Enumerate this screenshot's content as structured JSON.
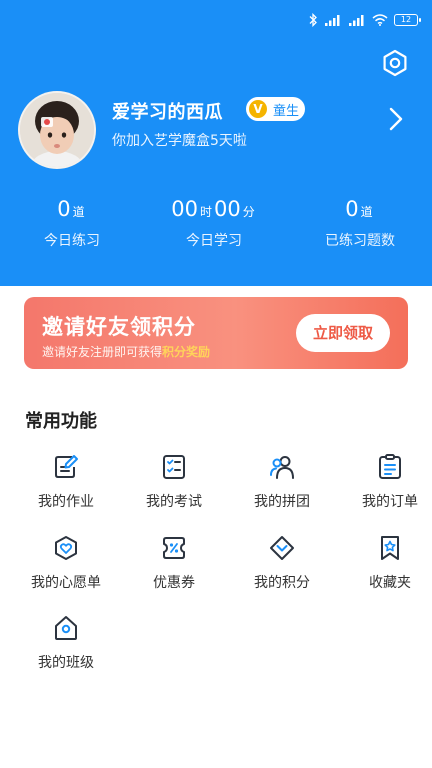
{
  "status": {
    "battery": "12",
    "signal1": "HD",
    "signal2": "HD"
  },
  "profile": {
    "nickname": "爱学习的西瓜",
    "badge_icon": "V",
    "badge_label": "童生",
    "joined_text": "你加入艺学魔盒5天啦"
  },
  "stats": [
    {
      "value": "0",
      "unit": "道",
      "label": "今日练习"
    },
    {
      "hours": "00",
      "hours_unit": "时",
      "minutes": "00",
      "minutes_unit": "分",
      "label": "今日学习"
    },
    {
      "value": "0",
      "unit": "道",
      "label": "已练习题数"
    }
  ],
  "banner": {
    "title": "邀请好友领积分",
    "subtitle_prefix": "邀请好友注册即可获得",
    "subtitle_highlight": "积分奖励",
    "button": "立即领取"
  },
  "section": {
    "title": "常用功能"
  },
  "features": [
    {
      "label": "我的作业",
      "icon": "homework-icon"
    },
    {
      "label": "我的考试",
      "icon": "exam-icon"
    },
    {
      "label": "我的拼团",
      "icon": "group-buy-icon"
    },
    {
      "label": "我的订单",
      "icon": "order-icon"
    },
    {
      "label": "我的心愿单",
      "icon": "wishlist-icon"
    },
    {
      "label": "优惠券",
      "icon": "coupon-icon"
    },
    {
      "label": "我的积分",
      "icon": "points-icon"
    },
    {
      "label": "收藏夹",
      "icon": "favorites-icon"
    },
    {
      "label": "我的班级",
      "icon": "class-icon"
    }
  ],
  "colors": {
    "primary": "#1a8ff7",
    "banner_start": "#f4776b",
    "banner_end": "#f46f5a",
    "highlight": "#ffd45a",
    "badge": "#f5b400",
    "icon_dark": "#2c3440",
    "icon_accent": "#1a8ff7"
  }
}
